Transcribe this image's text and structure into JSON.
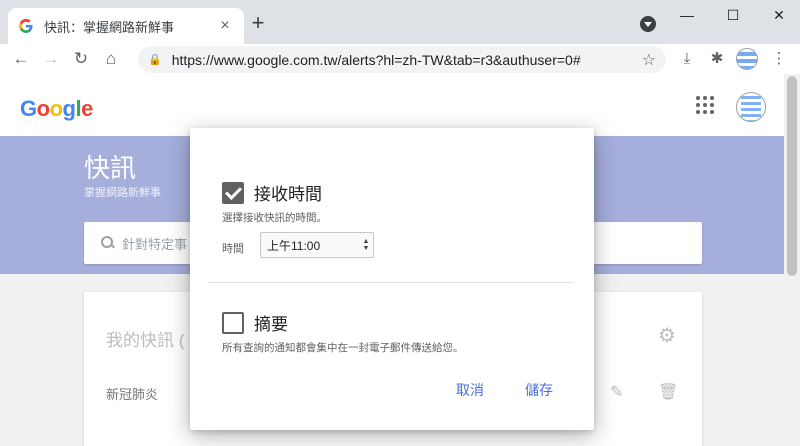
{
  "browser": {
    "tab_title": "快訊：掌握網路新鮮事",
    "tab_close": "×",
    "new_tab": "+",
    "url": "https://www.google.com.tw/alerts?hl=zh-TW&tab=r3&authuser=0#",
    "window_controls": {
      "minimize": "—",
      "maximize": "☐",
      "close": "✕"
    },
    "nav": {
      "back": "←",
      "forward": "→",
      "reload": "↻",
      "home": "⌂"
    },
    "icons": {
      "lock": "🔒",
      "star": "☆",
      "download": "⤓",
      "extensions": "✱",
      "menu": "⋮"
    }
  },
  "app": {
    "logo": [
      {
        "ch": "G",
        "color": "#4285F4"
      },
      {
        "ch": "o",
        "color": "#EA4335"
      },
      {
        "ch": "o",
        "color": "#FBBC05"
      },
      {
        "ch": "g",
        "color": "#4285F4"
      },
      {
        "ch": "l",
        "color": "#34A853"
      },
      {
        "ch": "e",
        "color": "#EA4335"
      }
    ]
  },
  "hero": {
    "title": "快訊",
    "subtitle": "掌握網路新鮮事",
    "search_placeholder": "針對特定事"
  },
  "card": {
    "title": "我的快訊 (",
    "alert_item": "新冠肺炎",
    "icons": {
      "gear": "⚙",
      "pencil": "✎",
      "trash": "🗑"
    }
  },
  "dialog": {
    "receive_time": {
      "label": "接收時間",
      "checked": true,
      "description": "選擇接收快訊的時間。",
      "time_label": "時間",
      "time_value": "上午11:00"
    },
    "digest": {
      "label": "摘要",
      "checked": false,
      "description": "所有查詢的通知都會集中在一封電子郵件傳送給您。"
    },
    "cancel_label": "取消",
    "save_label": "儲存"
  }
}
